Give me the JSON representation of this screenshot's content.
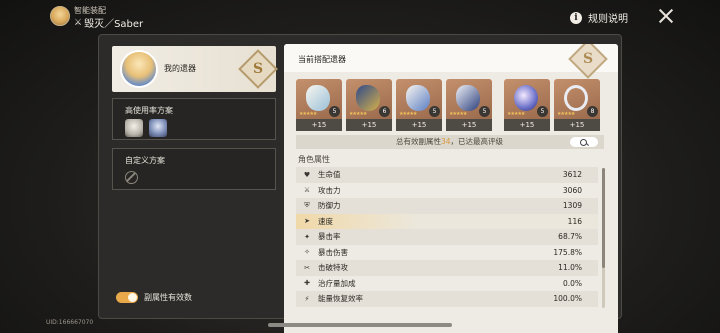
{
  "header": {
    "app_title": "智能装配",
    "path_icon": "destruction-path-icon",
    "character": "毁灭／Saber",
    "rules_label": "规则说明"
  },
  "left": {
    "my_relics_label": "我的遗器",
    "my_relics_grade": "S",
    "scheme_high_usage": "高使用率方案",
    "scheme_custom": "自定义方案",
    "toggle_label": "副属性有效数",
    "toggle_on": true
  },
  "right": {
    "title": "当前搭配遗器",
    "grade": "S",
    "relics": [
      {
        "name": "head",
        "level": "+15",
        "badge": "5",
        "stars": "★★★★★"
      },
      {
        "name": "hands",
        "level": "+15",
        "badge": "6",
        "stars": "★★★★★"
      },
      {
        "name": "body",
        "level": "+15",
        "badge": "5",
        "stars": "★★★★★"
      },
      {
        "name": "feet",
        "level": "+15",
        "badge": "5",
        "stars": "★★★★★"
      },
      {
        "name": "planar-sphere",
        "level": "+15",
        "badge": "5",
        "stars": "★★★★★"
      },
      {
        "name": "link-rope",
        "level": "+15",
        "badge": "8",
        "stars": "★★★★★"
      }
    ],
    "effective_summary_prefix": "总有效副属性",
    "effective_count": "34",
    "effective_summary_suffix": "，已达最高评级",
    "attributes_title": "角色属性",
    "attributes": [
      {
        "icon": "heart-icon",
        "glyph": "♥",
        "name": "生命值",
        "value": "3612"
      },
      {
        "icon": "sword-icon",
        "glyph": "⚔",
        "name": "攻击力",
        "value": "3060"
      },
      {
        "icon": "shield-icon",
        "glyph": "⛨",
        "name": "防御力",
        "value": "1309"
      },
      {
        "icon": "speed-icon",
        "glyph": "➤",
        "name": "速度",
        "value": "116"
      },
      {
        "icon": "crit-rate-icon",
        "glyph": "✦",
        "name": "暴击率",
        "value": "68.7%"
      },
      {
        "icon": "crit-dmg-icon",
        "glyph": "✧",
        "name": "暴击伤害",
        "value": "175.8%"
      },
      {
        "icon": "break-effect-icon",
        "glyph": "✂",
        "name": "击破特攻",
        "value": "11.0%"
      },
      {
        "icon": "heal-icon",
        "glyph": "✚",
        "name": "治疗量加成",
        "value": "0.0%"
      },
      {
        "icon": "energy-icon",
        "glyph": "⚡",
        "name": "能量恢复效率",
        "value": "100.0%"
      }
    ]
  },
  "footer": {
    "uid": "UID:166667070"
  }
}
